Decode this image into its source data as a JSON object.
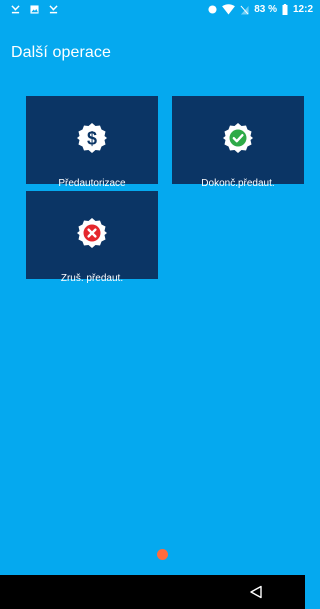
{
  "status_bar": {
    "battery_text": "83 %",
    "time": "12:2",
    "icons": [
      "missed-call-icon",
      "image-icon",
      "missed-call-icon",
      "circle-icon",
      "wifi-icon",
      "no-sim-icon",
      "battery-icon"
    ]
  },
  "screen": {
    "title": "Další operace"
  },
  "tiles": [
    {
      "label": "Předautorizace",
      "icon": "dollar-badge-icon",
      "badge_color": "#ffffff",
      "mark_color": "#0b3565"
    },
    {
      "label": "Dokonč.předaut.",
      "icon": "check-badge-icon",
      "badge_color": "#ffffff",
      "mark_color": "#2eaa47"
    },
    {
      "label": "Zruš. předaut.",
      "icon": "cross-badge-icon",
      "badge_color": "#ffffff",
      "mark_color": "#e5272d"
    }
  ],
  "pager": {
    "page_count": 1,
    "current_page": 1,
    "dot_color": "#ff6b3d"
  },
  "nav_bar": {
    "icons": [
      "back-icon"
    ]
  },
  "colors": {
    "background": "#05a9ef",
    "tile": "#0b3565"
  }
}
